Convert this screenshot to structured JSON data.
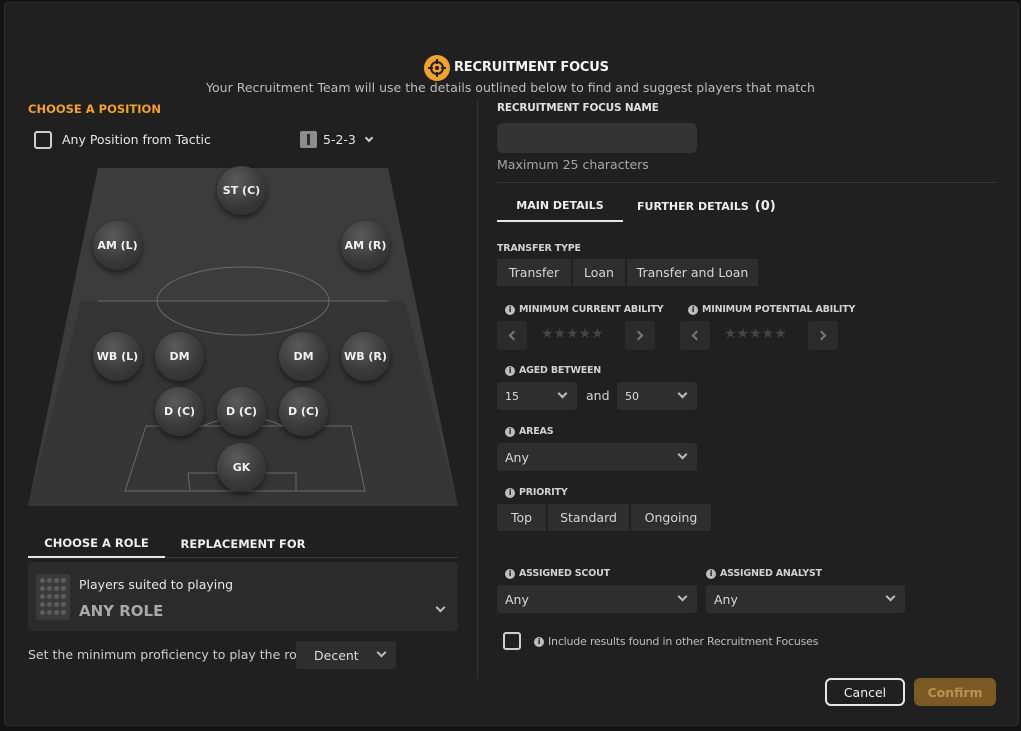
{
  "header": {
    "title": "RECRUITMENT FOCUS",
    "subtitle": "Your Recruitment Team will use the details outlined below to find and suggest players that match"
  },
  "position": {
    "heading": "CHOOSE A POSITION",
    "any_position_label": "Any Position from Tactic",
    "formation": "5-2-3",
    "players": [
      "ST (C)",
      "AM (L)",
      "AM (R)",
      "WB (L)",
      "DM",
      "DM",
      "WB (R)",
      "D (C)",
      "D (C)",
      "D (C)",
      "GK"
    ]
  },
  "role": {
    "tabs": [
      "CHOOSE A ROLE",
      "REPLACEMENT FOR"
    ],
    "suited_label": "Players suited to playing",
    "selected_role": "ANY ROLE",
    "proficiency_label": "Set the minimum proficiency to play the role",
    "proficiency_value": "Decent"
  },
  "form": {
    "name_label": "RECRUITMENT FOCUS NAME",
    "name_value": "",
    "name_hint": "Maximum 25 characters",
    "tabs": {
      "main": "MAIN DETAILS",
      "further": "FURTHER DETAILS",
      "further_count": "(0)"
    },
    "transfer_type_label": "TRANSFER TYPE",
    "transfer_types": [
      "Transfer",
      "Loan",
      "Transfer and Loan"
    ],
    "min_current_label": "MINIMUM CURRENT ABILITY",
    "min_potential_label": "MINIMUM POTENTIAL ABILITY",
    "stars_current": "★★★★★",
    "stars_potential": "★★★★★",
    "aged_label": "AGED BETWEEN",
    "age_min": "15",
    "and_label": "and",
    "age_max": "50",
    "areas_label": "AREAS",
    "areas_value": "Any",
    "priority_label": "PRIORITY",
    "priorities": [
      "Top",
      "Standard",
      "Ongoing"
    ],
    "scout_label": "ASSIGNED SCOUT",
    "scout_value": "Any",
    "analyst_label": "ASSIGNED ANALYST",
    "analyst_value": "Any",
    "include_label": "Include results found in other Recruitment Focuses"
  },
  "buttons": {
    "cancel": "Cancel",
    "confirm": "Confirm"
  },
  "colors": {
    "accent": "#f0a12e",
    "confirm_bg": "#7b5a24",
    "background": "#202020"
  }
}
